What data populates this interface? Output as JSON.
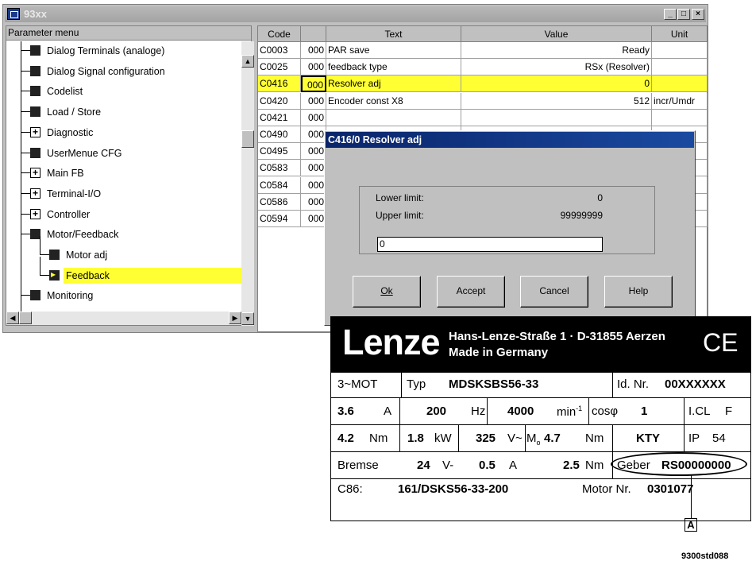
{
  "window": {
    "title": "93xx",
    "minimize": "_",
    "maximize": "□",
    "close": "×"
  },
  "tree": {
    "header": "Parameter menu",
    "items": [
      {
        "label": "Dialog Terminals (analoge)"
      },
      {
        "label": "Dialog Signal configuration"
      },
      {
        "label": "Codelist"
      },
      {
        "label": "Load / Store"
      },
      {
        "label": "Diagnostic"
      },
      {
        "label": "UserMenue CFG"
      },
      {
        "label": "Main FB"
      },
      {
        "label": "Terminal-I/O"
      },
      {
        "label": "Controller"
      },
      {
        "label": "Motor/Feedback"
      },
      {
        "label": "Motor adj"
      },
      {
        "label": "Feedback"
      },
      {
        "label": "Monitoring"
      }
    ]
  },
  "table": {
    "headers": [
      "Code",
      "",
      "Text",
      "Value",
      "Unit"
    ],
    "rows": [
      {
        "code": "C0003",
        "sub": "000",
        "text": "PAR save",
        "value": "Ready",
        "unit": ""
      },
      {
        "code": "C0025",
        "sub": "000",
        "text": "feedback type",
        "value": "RSx (Resolver)",
        "unit": ""
      },
      {
        "code": "C0416",
        "sub": "000",
        "text": "Resolver adj",
        "value": "0",
        "unit": ""
      },
      {
        "code": "C0420",
        "sub": "000",
        "text": "Encoder const X8",
        "value": "512",
        "unit": "incr/Umdr"
      },
      {
        "code": "C0421",
        "sub": "000",
        "text": "",
        "value": "",
        "unit": ""
      },
      {
        "code": "C0490",
        "sub": "000",
        "text": "",
        "value": "",
        "unit": ""
      },
      {
        "code": "C0495",
        "sub": "000",
        "text": "",
        "value": "",
        "unit": ""
      },
      {
        "code": "C0583",
        "sub": "000",
        "text": "",
        "value": "",
        "unit": ""
      },
      {
        "code": "C0584",
        "sub": "000",
        "text": "",
        "value": "",
        "unit": ""
      },
      {
        "code": "C0586",
        "sub": "000",
        "text": "",
        "value": "",
        "unit": ""
      },
      {
        "code": "C0594",
        "sub": "000",
        "text": "",
        "value": "",
        "unit": ""
      }
    ]
  },
  "dialog": {
    "title": "C416/0 Resolver adj",
    "lower_label": "Lower limit:",
    "lower_value": "0",
    "upper_label": "Upper limit:",
    "upper_value": "99999999",
    "input_value": "0",
    "buttons": {
      "ok": "Ok",
      "accept": "Accept",
      "cancel": "Cancel",
      "help": "Help"
    }
  },
  "nameplate": {
    "brand": "Lenze",
    "address1": "Hans-Lenze-Straße 1 · D-31855 Aerzen",
    "address2": "Made in Germany",
    "ce": "CE",
    "r1": {
      "mot": "3~MOT",
      "typ_label": "Typ",
      "typ": "MDSKSBS56-33",
      "id_label": "Id. Nr.",
      "id": "00XXXXXX"
    },
    "r2": {
      "amp": "3.6",
      "amp_u": "A",
      "hz": "200",
      "hz_u": "Hz",
      "rpm": "4000",
      "rpm_u": "min",
      "rpm_exp": "-1",
      "cos_label": "cosφ",
      "cos": "1",
      "icl": "I.CL",
      "icl_v": "F"
    },
    "r3": {
      "nm": "4.2",
      "nm_u": "Nm",
      "kw": "1.8",
      "kw_u": "kW",
      "v": "325",
      "v_u": "V~",
      "mo": "M",
      "mo_sub": "o",
      "mo_v": "4.7",
      "mo_u": "Nm",
      "kty": "KTY",
      "ip": "IP",
      "ip_v": "54"
    },
    "r4": {
      "bremse": "Bremse",
      "bv": "24",
      "bv_u": "V-",
      "ba": "0.5",
      "ba_u": "A",
      "bnm": "2.5",
      "bnm_u": "Nm",
      "geber_label": "Geber",
      "geber": "RS00000000"
    },
    "r5": {
      "c86": "C86:",
      "c86_v": "161/DSKS56-33-200",
      "motor_label": "Motor Nr.",
      "motor": "0301077"
    },
    "marker": "A"
  },
  "figure_id": "9300std088",
  "colors": {
    "highlight": "#ffff33",
    "dialog_title": "#0a246a"
  }
}
